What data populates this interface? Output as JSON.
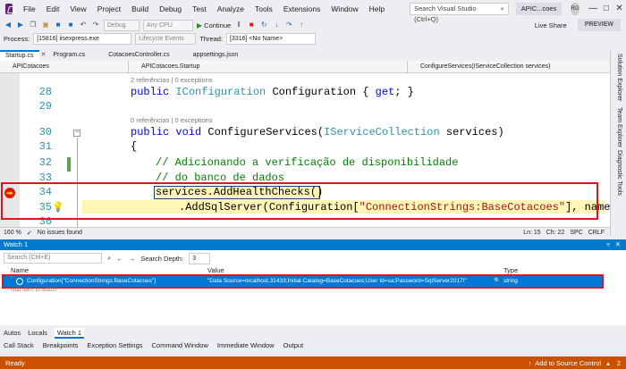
{
  "menubar": {
    "items": [
      "File",
      "Edit",
      "View",
      "Project",
      "Build",
      "Debug",
      "Test",
      "Analyze",
      "Tools",
      "Extensions",
      "Window",
      "Help"
    ],
    "search_placeholder": "Search Visual Studio (Ctrl+Q)",
    "app_title": "APIC...coes",
    "avatar_initials": "RG"
  },
  "toolbar": {
    "config_combo": "Debug",
    "platform_combo": "Any CPU",
    "continue_label": "Continue",
    "live_share": "Live Share",
    "preview": "PREVIEW"
  },
  "debugbar": {
    "process_label": "Process:",
    "process_value": "[15816] iisexpress.exe",
    "lifecycle": "Lifecycle Events",
    "thread_label": "Thread:",
    "thread_value": "[3316] <No Name>"
  },
  "tabs": [
    "Startup.cs",
    "Program.cs",
    "CotacoesController.cs",
    "appsettings.json"
  ],
  "navbar": {
    "project": "APICotacoes",
    "class": "APICotacoes.Startup",
    "member": "ConfigureServices(IServiceCollection services)"
  },
  "editor": {
    "lines": [
      "28",
      "29",
      "30",
      "31",
      "32",
      "33",
      "34",
      "35",
      "36"
    ],
    "ref1": "2 referências | 0 exceptions",
    "ref2": "0 referências | 0 exceptions",
    "l28_a": "public ",
    "l28_b": "IConfiguration",
    "l28_c": " Configuration { ",
    "l28_d": "get",
    "l28_e": "; }",
    "l30_a": "public void ",
    "l30_b": "ConfigureServices(",
    "l30_c": "IServiceCollection",
    "l30_d": " services)",
    "l31": "{",
    "l32": "// Adicionando a verificação de disponibilidade",
    "l33": "// do banco de dados",
    "l34": "services.AddHealthChecks()",
    "l35_a": ".AddSqlServer(Configuration[",
    "l35_b": "\"ConnectionStrings:BaseCotacoes\"",
    "l35_c": "], name:"
  },
  "zoombar": {
    "zoom": "160 %",
    "status": "No issues found",
    "line": "Ln: 15",
    "ch": "Ch: 22",
    "spc": "SPC",
    "crlf": "CRLF"
  },
  "watch": {
    "title": "Watch 1",
    "search_placeholder": "Search (Ctrl+E)",
    "search_depth_label": "Search Depth:",
    "search_depth_value": "3",
    "col_name": "Name",
    "col_value": "Value",
    "col_type": "Type",
    "row_name": "Configuration[\"ConnectionStrings:BaseCotacoes\"]",
    "row_value": "\"Data Source=localhost,31433;Initial Catalog=BaseCotacoes;User Id=sa;Password=SqlServer2017!\"",
    "row_type": "string",
    "add_item": "Add item to watch"
  },
  "bottom_tabs": [
    "Autos",
    "Locals",
    "Watch 1"
  ],
  "tool_tabs": [
    "Call Stack",
    "Breakpoints",
    "Exception Settings",
    "Command Window",
    "Immediate Window",
    "Output"
  ],
  "statusbar": {
    "ready": "Ready",
    "source_control": "Add to Source Control",
    "count": "2"
  },
  "side_panel": [
    "Solution Explorer",
    "Team Explorer",
    "Diagnostic Tools"
  ],
  "colors": {
    "accent": "#007acc",
    "status": "#ca5100",
    "highlight_box": "#e81123",
    "breakpoint": "#e51400"
  }
}
